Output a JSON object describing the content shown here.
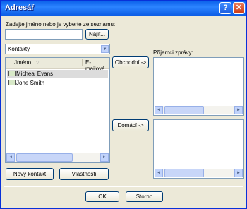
{
  "window": {
    "title": "Adresář",
    "help_glyph": "?",
    "close_glyph": "✕"
  },
  "search": {
    "prompt": "Zadejte jméno nebo je vyberte ze seznamu:",
    "value": "",
    "find_label": "Najít..."
  },
  "source": {
    "selected": "Kontakty"
  },
  "contacts": {
    "columns": [
      "Jméno",
      "E-mailová"
    ],
    "sort_glyph": "▽",
    "rows": [
      {
        "name": "Micheal Evans"
      },
      {
        "name": "Jone Smith"
      }
    ]
  },
  "scroll": {
    "left_glyph": "◄",
    "right_glyph": "►"
  },
  "buttons": {
    "commercial": "Obchodní ->",
    "home": "Domácí ->",
    "new_contact": "Nový kontakt",
    "properties": "Vlastnosti",
    "ok": "OK",
    "cancel": "Storno"
  },
  "recipients": {
    "label": "Příjemci zprávy:"
  }
}
